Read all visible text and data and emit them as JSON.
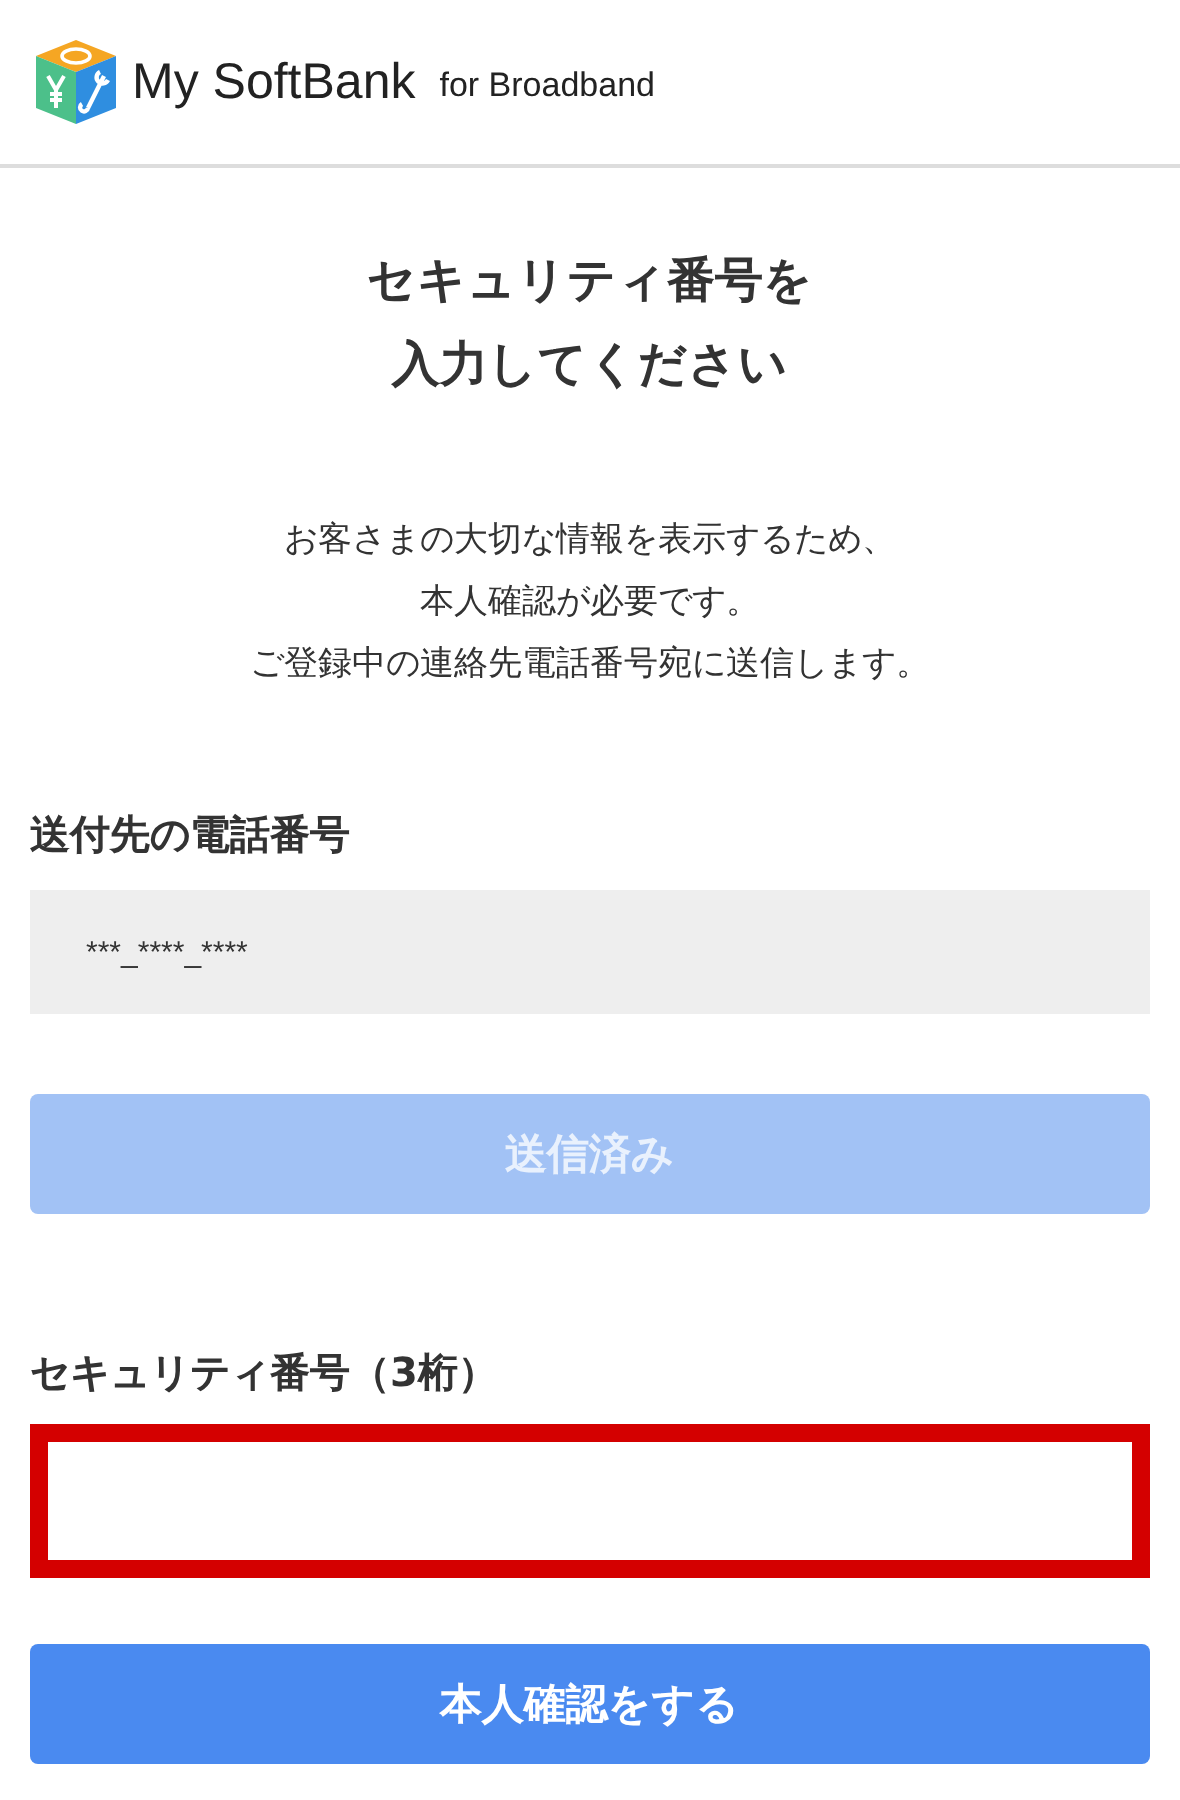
{
  "header": {
    "logo_main": "My SoftBank",
    "logo_sub": "for Broadband"
  },
  "title_lines": [
    "セキュリティ番号を",
    "入力してください"
  ],
  "description_lines": [
    "お客さまの大切な情報を表示するため、",
    "本人確認が必要です。",
    "ご登録中の連絡先電話番号宛に送信します。"
  ],
  "phone": {
    "label": "送付先の電話番号",
    "value": "***_****_****"
  },
  "send_button": {
    "label": "送信済み",
    "disabled": true
  },
  "security_code": {
    "label": "セキュリティ番号（3桁）",
    "error": true
  },
  "submit_button": {
    "label": "本人確認をする",
    "disabled": false
  }
}
